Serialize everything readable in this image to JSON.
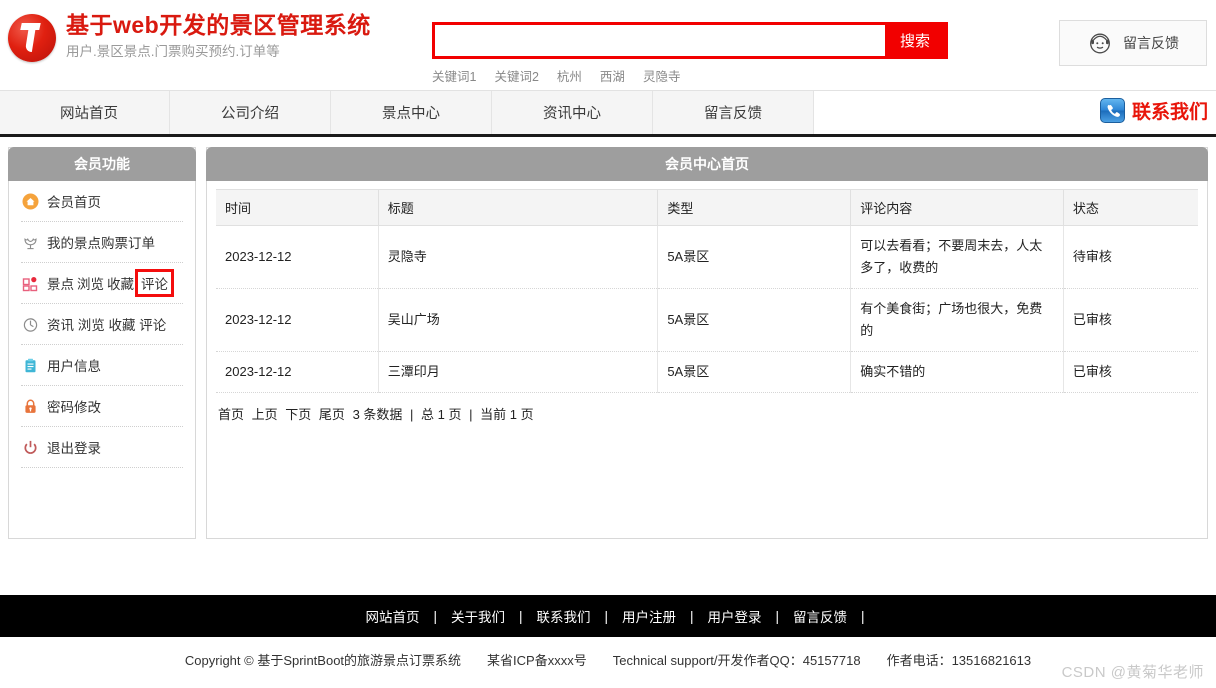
{
  "header": {
    "logo_icon": "circle-j-logo-icon",
    "brand_title": "基于web开发的景区管理系统",
    "brand_subtitle": "用户.景区景点.门票购买预约.订单等",
    "search": {
      "value": "",
      "placeholder": "",
      "button_label": "搜索",
      "border_color": "#f20000",
      "keywords": [
        "关键词1",
        "关键词2",
        "杭州",
        "西湖",
        "灵隐寺"
      ]
    },
    "feedback": {
      "icon": "customer-service-face-icon",
      "label": "留言反馈"
    }
  },
  "nav": {
    "items": [
      {
        "label": "网站首页"
      },
      {
        "label": "公司介绍"
      },
      {
        "label": "景点中心"
      },
      {
        "label": "资讯中心"
      },
      {
        "label": "留言反馈"
      }
    ],
    "contact": {
      "icon": "phone-icon",
      "label": "联系我们",
      "color": "#e8150a"
    }
  },
  "sidebar": {
    "title": "会员功能",
    "items": [
      {
        "icon": "home-circle-icon",
        "icon_color": "#f5a33c",
        "label": "会员首页",
        "segments": [
          "会员首页"
        ],
        "highlight": null
      },
      {
        "icon": "tulip-flower-icon",
        "icon_color": "#8c8c8c",
        "label": "我的景点购票订单",
        "segments": [
          "我的景点购票订单"
        ],
        "highlight": null
      },
      {
        "icon": "grid-squares-icon",
        "icon_color": "#e8607d",
        "label": "景点 浏览 收藏 评论",
        "segments": [
          "景点",
          "浏览",
          "收藏",
          "评论"
        ],
        "highlight": "评论"
      },
      {
        "icon": "clock-icon",
        "icon_color": "#8c8c8c",
        "label": "资讯 浏览 收藏 评论",
        "segments": [
          "资讯",
          "浏览",
          "收藏",
          "评论"
        ],
        "highlight": null
      },
      {
        "icon": "clipboard-icon",
        "icon_color": "#3fb6d6",
        "label": "用户信息",
        "segments": [
          "用户信息"
        ],
        "highlight": null
      },
      {
        "icon": "lock-icon",
        "icon_color": "#e8743c",
        "label": "密码修改",
        "segments": [
          "密码修改"
        ],
        "highlight": null
      },
      {
        "icon": "power-icon",
        "icon_color": "#d05a5a",
        "label": "退出登录",
        "segments": [
          "退出登录"
        ],
        "highlight": null
      }
    ]
  },
  "content": {
    "title": "会员中心首页",
    "table": {
      "columns": [
        "时间",
        "标题",
        "类型",
        "评论内容",
        "状态"
      ],
      "rows": [
        {
          "time": "2023-12-12",
          "title": "灵隐寺",
          "type": "5A景区",
          "comment": "可以去看看；不要周末去，人太多了，收费的",
          "status": "待审核",
          "status_type": "pending"
        },
        {
          "time": "2023-12-12",
          "title": "吴山广场",
          "type": "5A景区",
          "comment": "有个美食街；广场也很大，免费的",
          "status": "已审核",
          "status_type": "done"
        },
        {
          "time": "2023-12-12",
          "title": "三潭印月",
          "type": "5A景区",
          "comment": "确实不错的",
          "status": "已审核",
          "status_type": "done"
        }
      ]
    },
    "pager": {
      "first": "首页",
      "prev": "上页",
      "next": "下页",
      "last": "尾页",
      "count_text": "3 条数据",
      "total_pages_text": "总 1 页",
      "current_page_text": "当前 1 页"
    }
  },
  "footer": {
    "links": [
      "网站首页",
      "关于我们",
      "联系我们",
      "用户注册",
      "用户登录",
      "留言反馈"
    ],
    "copyright": "Copyright © 基于SprintBoot的旅游景点订票系统",
    "icp": "某省ICP备xxxx号",
    "support": "Technical support/开发作者QQ：45157718",
    "phone": "作者电话：13516821613",
    "watermark": "CSDN @黄菊华老师"
  }
}
